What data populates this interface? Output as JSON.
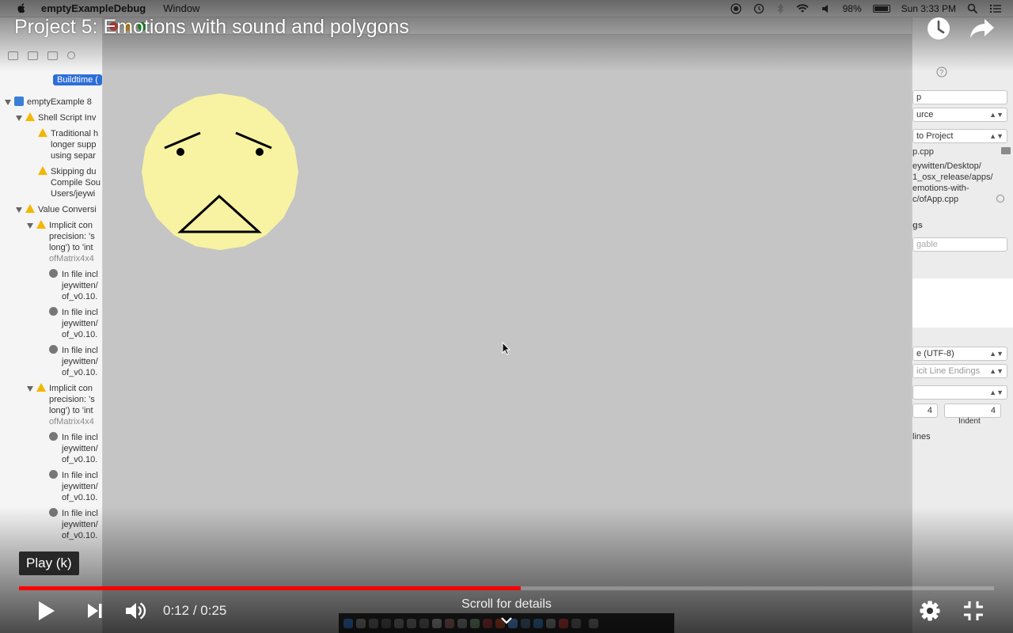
{
  "video": {
    "title": "Project 5: Emotions with sound and polygons",
    "tooltip": "Play (k)",
    "current_time": "0:12",
    "separator": " / ",
    "duration": "0:25",
    "progress_fraction": 0.515,
    "scroll_hint": "Scroll for details",
    "progress_color": "#ff0000"
  },
  "controls": {
    "icons": [
      "play-icon",
      "next-icon",
      "volume-icon",
      "settings-icon",
      "exit-fullscreen-icon",
      "watch-later-icon",
      "share-icon"
    ]
  },
  "menubar": {
    "app_name": "emptyExampleDebug",
    "menu_window": "Window",
    "battery": "98%",
    "clock": "Sun 3:33 PM"
  },
  "navigator": {
    "buildtime": "Buildtime (",
    "rows": [
      {
        "text": "emptyExample  8"
      },
      {
        "text": "Shell Script Inv"
      },
      {
        "text": "Traditional h\nlonger supp\nusing separ"
      },
      {
        "text": "Skipping du\nCompile Sou\nUsers/jeywi"
      },
      {
        "text": "Value Conversi"
      },
      {
        "text": "Implicit con\nprecision: 's\nlong') to 'int",
        "sub": "ofMatrix4x4"
      },
      {
        "text": "In file incl\njeywitten/\nof_v0.10."
      },
      {
        "text": "In file incl\njeywitten/\nof_v0.10."
      },
      {
        "text": "In file incl\njeywitten/\nof_v0.10."
      },
      {
        "text": "Implicit con\nprecision: 's\nlong') to 'int",
        "sub": "ofMatrix4x4"
      },
      {
        "text": "In file incl\njeywitten/\nof_v0.10."
      },
      {
        "text": "In file incl\njeywitten/\nof_v0.10."
      },
      {
        "text": "In file incl\njeywitten/\nof_v0.10."
      }
    ]
  },
  "inspector": {
    "name_field": "p",
    "source_select": "urce",
    "location_select": "to Project",
    "file_name": "p.cpp",
    "path": "eywitten/Desktop/\n1_osx_release/apps/\nemotions-with-\nc/ofApp.cpp",
    "section_label": "gs",
    "localizable_placeholder": "gable",
    "encoding": "e (UTF-8)",
    "line_endings": "icit Line Endings",
    "tab_value": "4",
    "indent_value": "4",
    "indent_label": "Indent",
    "wrap_label": "lines"
  },
  "face": {
    "fill": "#f7f3a3",
    "emotion": "worried"
  }
}
